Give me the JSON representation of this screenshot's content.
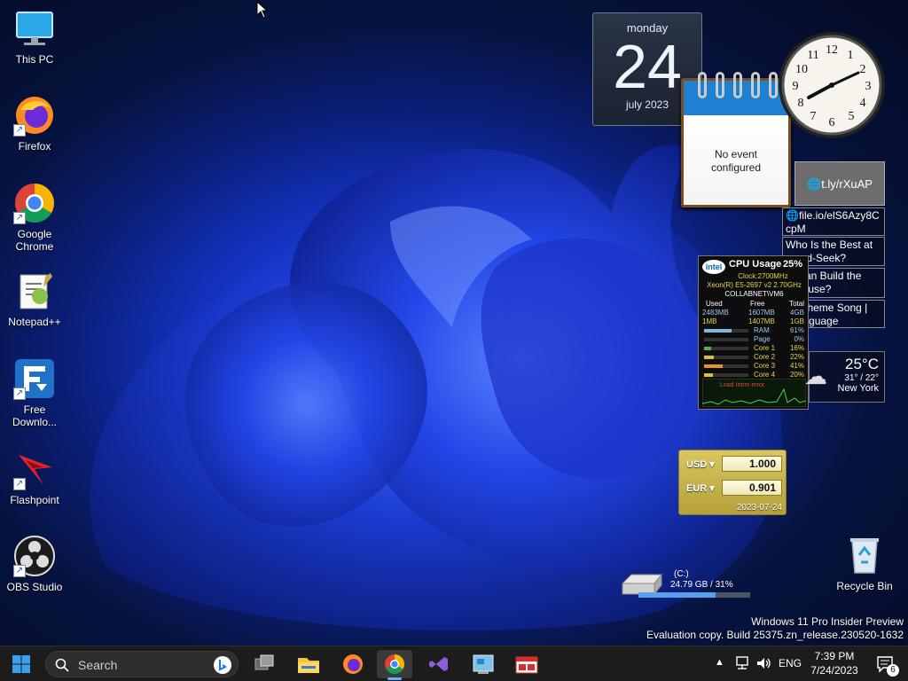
{
  "desktop": {
    "icons": [
      {
        "label": "This PC"
      },
      {
        "label": "Firefox"
      },
      {
        "label": "Google Chrome"
      },
      {
        "label": "Notepad++"
      },
      {
        "label": "Free Downlo..."
      },
      {
        "label": "Flashpoint"
      },
      {
        "label": "OBS Studio"
      }
    ],
    "recycle_bin": "Recycle Bin"
  },
  "gadgets": {
    "calendar": {
      "weekday": "monday",
      "day": "24",
      "month_year": "july 2023"
    },
    "calendar_notes": {
      "line1": "No event",
      "line2": "configured"
    },
    "feed": {
      "header": "t.ly/rXuAP",
      "items": [
        "file.io/elS6Azy8C cpM",
        "Who Is the Best at ...and-Seek?",
        "... Can Build the ...House?",
        "...r Theme Song | ...language"
      ]
    },
    "cpu": {
      "title": "CPU Usage",
      "percent": "25%",
      "logo": "intel",
      "clock": "Clock:2700MHz",
      "model": "Xeon(R) E5-2697 v2 2.70GHz",
      "host": "COLLABNET\\VM6",
      "headers": [
        "Used",
        "Free",
        "Total"
      ],
      "ram_row": [
        "2483MB",
        "1607MB",
        "4GB"
      ],
      "page_row": [
        "1MB",
        "1407MB",
        "1GB"
      ],
      "bars": [
        {
          "label": "RAM",
          "value": "61%",
          "fill": 0.61,
          "color": "#7fb6e6"
        },
        {
          "label": "Page",
          "value": "0%",
          "fill": 0.0,
          "color": "#7fb6e6"
        },
        {
          "label": "Core 1",
          "value": "16%",
          "fill": 0.16,
          "color": "#4fb14f"
        },
        {
          "label": "Core 2",
          "value": "22%",
          "fill": 0.22,
          "color": "#d8c23a"
        },
        {
          "label": "Core 3",
          "value": "41%",
          "fill": 0.41,
          "color": "#e2932c"
        },
        {
          "label": "Core 4",
          "value": "20%",
          "fill": 0.2,
          "color": "#d8c23a"
        }
      ],
      "graph_label": "Load   Intrm    error"
    },
    "weather": {
      "temp": "25°C",
      "range": "31° / 22°",
      "city": "New York"
    },
    "currency": {
      "rows": [
        {
          "code": "USD",
          "value": "1.000"
        },
        {
          "code": "EUR",
          "value": "0.901"
        }
      ],
      "date": "2023-07-24"
    },
    "drive": {
      "name": "(C:)",
      "size": "24.79 GB / 31%",
      "fill": 0.69
    }
  },
  "watermark": {
    "line1": "Windows 11 Pro Insider Preview",
    "line2": "Evaluation copy. Build 25375.zn_release.230520-1632"
  },
  "taskbar": {
    "search_label": "Search",
    "lang": "ENG",
    "time": "7:39 PM",
    "date": "7/24/2023",
    "notification_count": "6"
  },
  "colors": {
    "accent": "#0078d4",
    "taskbar": "#1c1c1c"
  }
}
